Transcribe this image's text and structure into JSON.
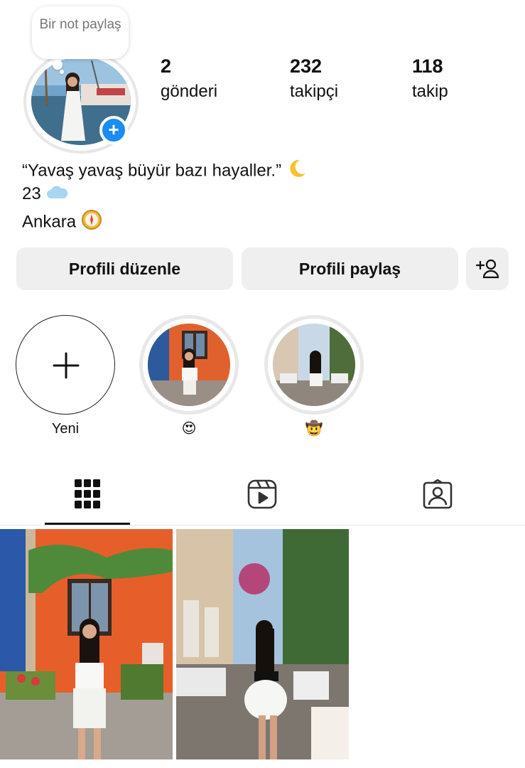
{
  "note": {
    "text": "Bir not paylaş"
  },
  "stats": [
    {
      "value": "2",
      "label": "gönderi"
    },
    {
      "value": "232",
      "label": "takipçi"
    },
    {
      "value": "118",
      "label": "takip"
    }
  ],
  "bio": {
    "line1": "“Yavaş yavaş büyür bazı hayaller.”",
    "line1_emoji": "crescent-moon",
    "line2": "23",
    "line2_emoji": "cloud",
    "line3": "Ankara",
    "line3_emoji": "compass"
  },
  "buttons": {
    "edit_profile": "Profili düzenle",
    "share_profile": "Profili paylaş",
    "add_person_icon": "add-person-icon"
  },
  "highlights": [
    {
      "label": "Yeni",
      "icon": "plus-icon"
    },
    {
      "label": "😍",
      "icon": "heart-eyes-emoji"
    },
    {
      "label": "🤠",
      "icon": "cowboy-emoji"
    }
  ],
  "tabs": [
    {
      "icon": "grid-icon",
      "active": true
    },
    {
      "icon": "reels-icon",
      "active": false
    },
    {
      "icon": "tagged-icon",
      "active": false
    }
  ],
  "colors": {
    "accent": "#1a8cf2",
    "button_bg": "#efefef",
    "text": "#111111"
  }
}
